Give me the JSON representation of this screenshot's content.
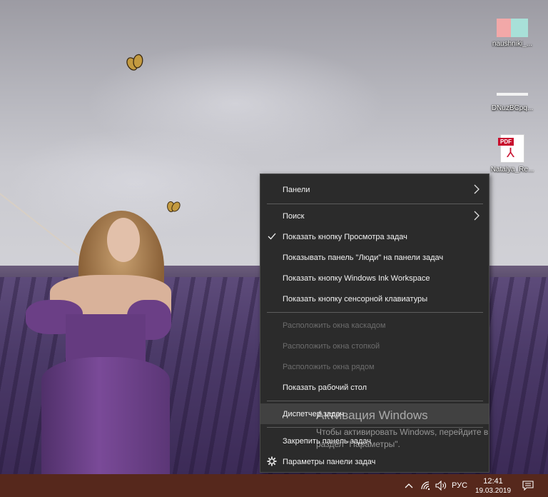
{
  "desktop": {
    "icons": [
      {
        "label": "naushniki_..."
      },
      {
        "label": "DNuzBCpq..."
      },
      {
        "label": "Natalya_Re...",
        "tag": "PDF"
      }
    ]
  },
  "context_menu": {
    "items": [
      {
        "label": "Панели",
        "submenu": true,
        "enabled": true
      },
      {
        "label": "Поиск",
        "submenu": true,
        "enabled": true
      },
      {
        "label": "Показать кнопку Просмотра задач",
        "checked": true,
        "enabled": true
      },
      {
        "label": "Показывать панель \"Люди\" на панели задач",
        "enabled": true
      },
      {
        "label": "Показать кнопку Windows Ink Workspace",
        "enabled": true
      },
      {
        "label": "Показать кнопку сенсорной клавиатуры",
        "enabled": true
      },
      {
        "label": "Расположить окна каскадом",
        "enabled": false
      },
      {
        "label": "Расположить окна стопкой",
        "enabled": false
      },
      {
        "label": "Расположить окна рядом",
        "enabled": false
      },
      {
        "label": "Показать рабочий стол",
        "enabled": true
      },
      {
        "label": "Диспетчер задач",
        "enabled": true,
        "highlighted": true
      },
      {
        "label": "Закрепить панель задач",
        "enabled": true
      },
      {
        "label": "Параметры панели задач",
        "enabled": true,
        "icon": "gear-icon"
      }
    ]
  },
  "watermark": {
    "title": "Активация Windows",
    "line1": "Чтобы активировать Windows, перейдите в",
    "line2": "раздел \"Параметры\"."
  },
  "taskbar": {
    "language": "РУС",
    "time": "12:41",
    "date": "19.03.2019",
    "colors": {
      "taskbar": "#56281c",
      "menu_bg": "#2b2b2b",
      "menu_highlight": "#414141"
    }
  }
}
